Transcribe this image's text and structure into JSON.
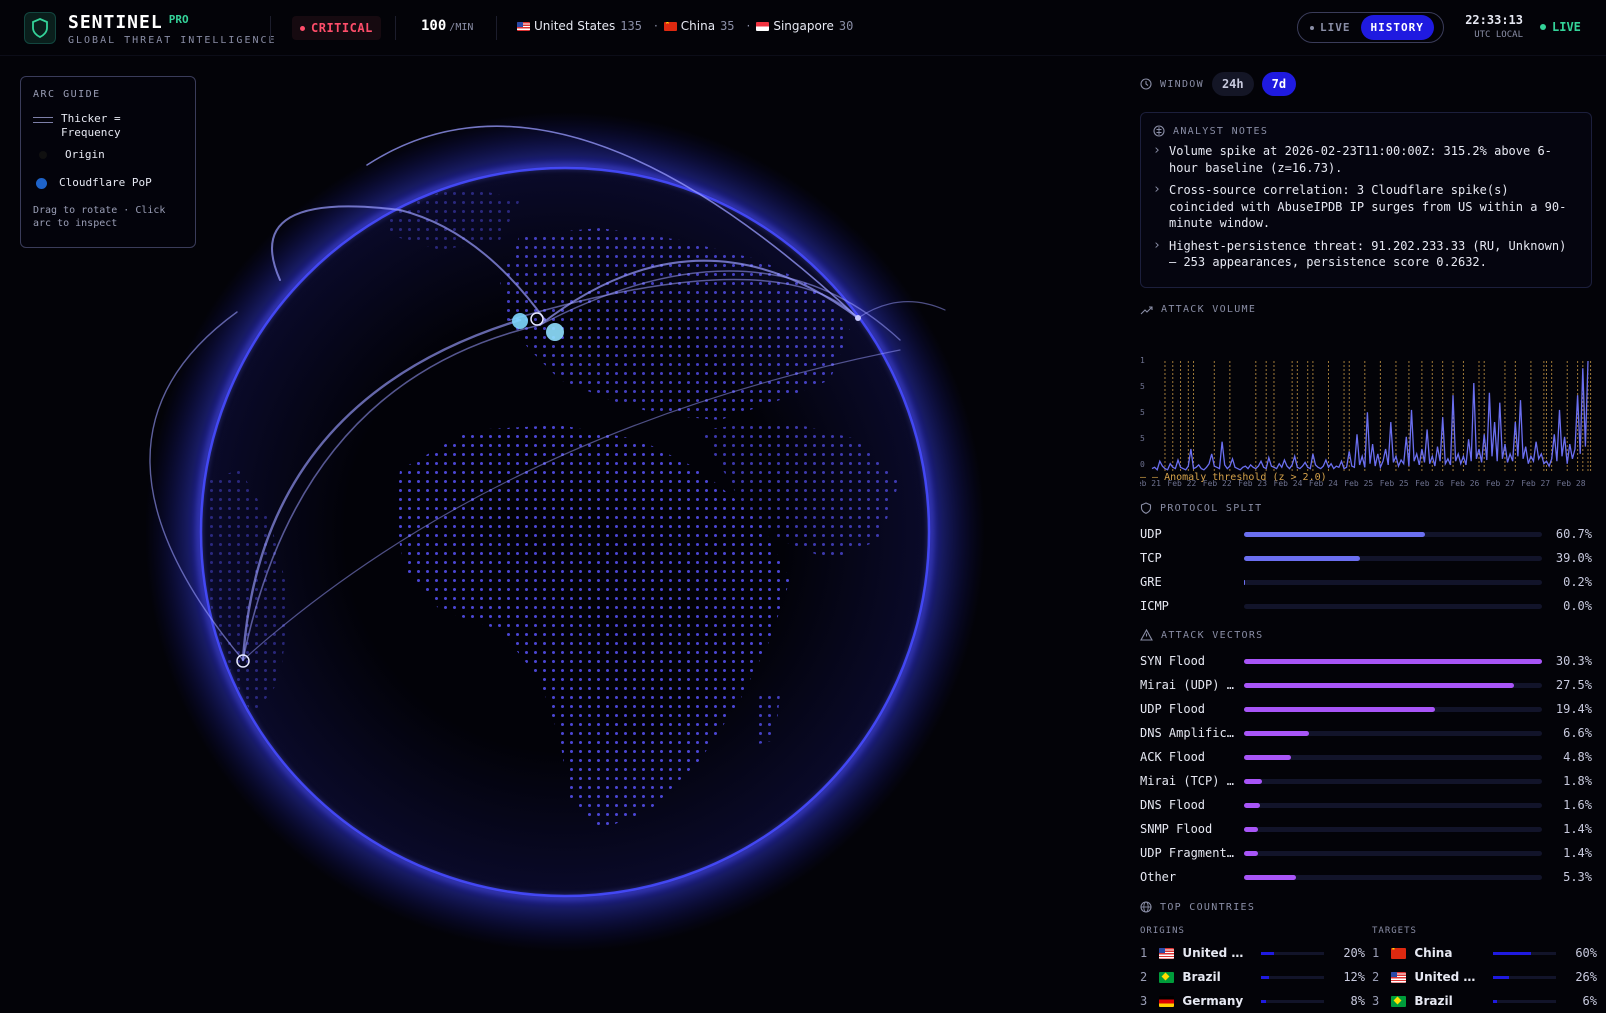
{
  "header": {
    "brand": "SENTINEL",
    "badge": "PRO",
    "subtitle": "GLOBAL THREAT INTELLIGENCE",
    "threat_level": "CRITICAL",
    "rate_value": "100",
    "rate_unit": "/MIN",
    "top_origins": [
      {
        "flag": "us",
        "name": "United States",
        "count": "135"
      },
      {
        "flag": "cn",
        "name": "China",
        "count": "35"
      },
      {
        "flag": "sg",
        "name": "Singapore",
        "count": "30"
      }
    ],
    "mode_live": "LIVE",
    "mode_history": "HISTORY",
    "time": "22:33:13",
    "timezone": "UTC LOCAL",
    "live_status": "LIVE",
    "colors": {
      "accent": "#1f1ae0",
      "critical": "#ff4d6a",
      "live": "#34d399"
    }
  },
  "arc_guide": {
    "title": "ARC GUIDE",
    "thickness_label": "Thicker = Frequency",
    "origin_label": "Origin",
    "pop_label": "Cloudflare PoP",
    "hint": "Drag to rotate · Click arc to inspect"
  },
  "panel": {
    "window_label": "WINDOW",
    "window_options": [
      "24h",
      "7d"
    ],
    "window_selected": "7d",
    "notes_title": "ANALYST NOTES",
    "notes": [
      "Volume spike at 2026-02-23T11:00:00Z: 315.2% above 6-hour baseline (z=16.73).",
      "Cross-source correlation: 3 Cloudflare spike(s) coincided with AbuseIPDB IP surges from US within a 90-minute window.",
      "Highest-persistence threat: 91.202.233.33 (RU, Unknown) — 253 appearances, persistence score 0.2632."
    ],
    "volume_title": "ATTACK VOLUME",
    "threshold_label": "— — Anomaly threshold (z > 2.0)",
    "protocol_title": "PROTOCOL SPLIT",
    "protocols": [
      {
        "label": "UDP",
        "pct": "60.7%",
        "value": 60.7
      },
      {
        "label": "TCP",
        "pct": "39.0%",
        "value": 39.0
      },
      {
        "label": "GRE",
        "pct": "0.2%",
        "value": 0.2
      },
      {
        "label": "ICMP",
        "pct": "0.0%",
        "value": 0.0
      }
    ],
    "vectors_title": "ATTACK VECTORS",
    "vectors": [
      {
        "label": "SYN Flood",
        "pct": "30.3%",
        "value": 30.3
      },
      {
        "label": "Mirai (UDP) …",
        "pct": "27.5%",
        "value": 27.5
      },
      {
        "label": "UDP Flood",
        "pct": "19.4%",
        "value": 19.4
      },
      {
        "label": "DNS Amplific…",
        "pct": "6.6%",
        "value": 6.6
      },
      {
        "label": "ACK Flood",
        "pct": "4.8%",
        "value": 4.8
      },
      {
        "label": "Mirai (TCP) …",
        "pct": "1.8%",
        "value": 1.8
      },
      {
        "label": "DNS Flood",
        "pct": "1.6%",
        "value": 1.6
      },
      {
        "label": "SNMP Flood",
        "pct": "1.4%",
        "value": 1.4
      },
      {
        "label": "UDP Fragment…",
        "pct": "1.4%",
        "value": 1.4
      },
      {
        "label": "Other",
        "pct": "5.3%",
        "value": 5.3
      }
    ],
    "countries_title": "TOP COUNTRIES",
    "origins_label": "ORIGINS",
    "targets_label": "TARGETS",
    "origins": [
      {
        "rank": "1",
        "flag": "us",
        "name": "United …",
        "pct": "20%",
        "value": 20
      },
      {
        "rank": "2",
        "flag": "br",
        "name": "Brazil",
        "pct": "12%",
        "value": 12
      },
      {
        "rank": "3",
        "flag": "de",
        "name": "Germany",
        "pct": "8%",
        "value": 8
      }
    ],
    "targets": [
      {
        "rank": "1",
        "flag": "cn",
        "name": "China",
        "pct": "60%",
        "value": 60
      },
      {
        "rank": "2",
        "flag": "us",
        "name": "United …",
        "pct": "26%",
        "value": 26
      },
      {
        "rank": "3",
        "flag": "br",
        "name": "Brazil",
        "pct": "6%",
        "value": 6
      }
    ]
  },
  "chart_data": {
    "type": "line",
    "title": "ATTACK VOLUME",
    "y_tick_labels": [
      "1",
      "5",
      "5",
      "5",
      "0"
    ],
    "x_tick_labels": [
      "Feb 21",
      "Feb 22",
      "Feb 22",
      "Feb 23",
      "Feb 24",
      "Feb 24",
      "Feb 25",
      "Feb 25",
      "Feb 26",
      "Feb 26",
      "Feb 27",
      "Feb 27",
      "Feb 28"
    ],
    "series": [
      {
        "values": [
          2,
          3,
          1,
          8,
          4,
          2,
          1,
          6,
          3,
          2,
          9,
          3,
          2,
          1,
          4,
          18,
          2,
          3,
          5,
          2,
          1,
          3,
          6,
          14,
          4,
          3,
          2,
          24,
          5,
          2,
          4,
          10,
          3,
          2,
          1,
          3,
          4,
          2,
          5,
          3,
          2,
          4,
          8,
          3,
          2,
          11,
          4,
          3,
          2,
          6,
          3,
          9,
          4,
          2,
          5,
          12,
          3,
          2,
          4,
          7,
          3,
          2,
          14,
          5,
          3,
          2,
          4,
          9,
          3,
          6,
          2,
          4,
          3,
          8,
          2,
          3,
          16,
          4,
          3,
          30,
          5,
          12,
          3,
          48,
          6,
          22,
          4,
          14,
          3,
          8,
          18,
          5,
          40,
          7,
          12,
          4,
          9,
          6,
          28,
          4,
          50,
          8,
          14,
          5,
          18,
          7,
          34,
          6,
          12,
          4,
          20,
          8,
          44,
          6,
          10,
          5,
          62,
          8,
          14,
          6,
          12,
          5,
          26,
          8,
          72,
          10,
          18,
          7,
          30,
          9,
          64,
          12,
          40,
          8,
          56,
          10,
          22,
          7,
          14,
          8,
          40,
          12,
          58,
          10,
          20,
          6,
          12,
          8,
          24,
          10,
          14,
          6,
          8,
          4,
          10,
          30,
          8,
          50,
          12,
          28,
          6,
          22,
          10,
          18,
          62,
          14,
          84,
          20,
          90
        ]
      }
    ],
    "anomaly_markers": [
      5,
      8,
      11,
      14,
      16,
      24,
      30,
      40,
      44,
      47,
      54,
      56,
      60,
      62,
      68,
      74,
      76,
      82,
      88,
      94,
      99,
      104,
      108,
      112,
      116,
      120,
      126,
      128,
      136,
      140,
      146,
      151,
      152,
      154,
      160,
      164,
      166,
      168,
      169
    ],
    "anomaly_threshold": "z > 2.0"
  }
}
